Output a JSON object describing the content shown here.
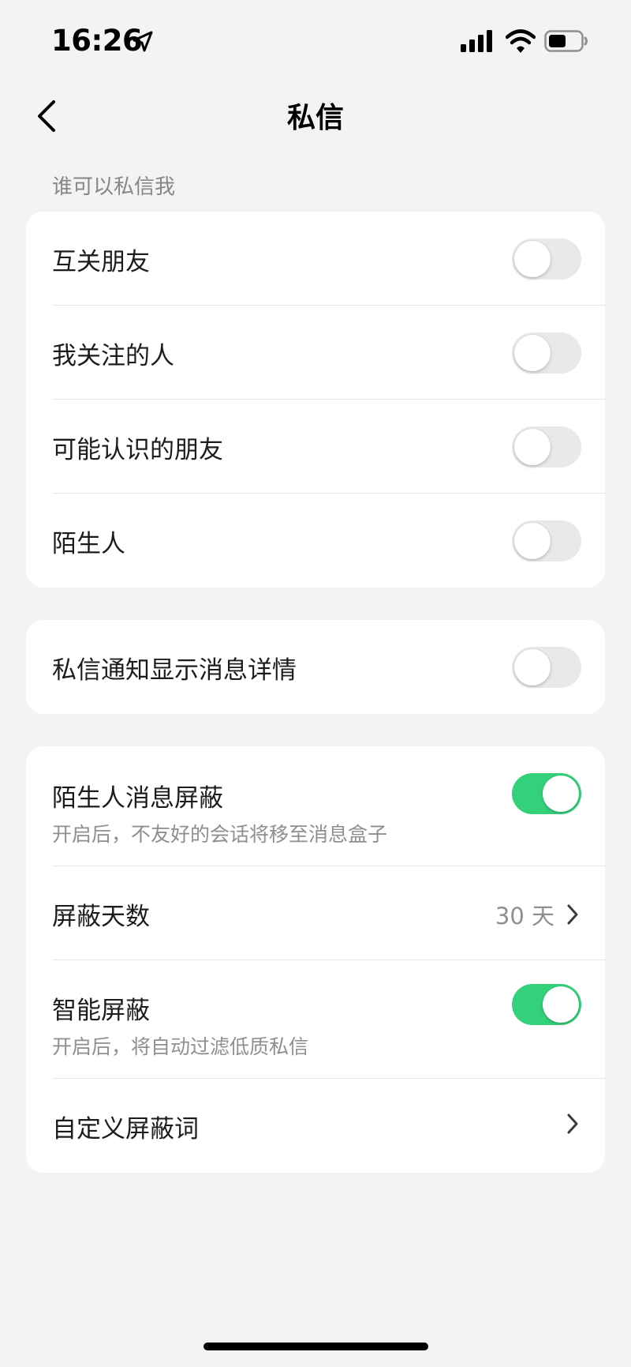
{
  "status_bar": {
    "time": "16:26",
    "icons": [
      "location-icon",
      "signal-icon",
      "wifi-icon",
      "battery-icon"
    ]
  },
  "nav": {
    "title": "私信",
    "back_icon": "chevron-left-icon"
  },
  "section_who": {
    "header": "谁可以私信我",
    "items": [
      {
        "label": "互关朋友",
        "on": false
      },
      {
        "label": "我关注的人",
        "on": false
      },
      {
        "label": "可能认识的朋友",
        "on": false
      },
      {
        "label": "陌生人",
        "on": false
      }
    ]
  },
  "notification": {
    "label": "私信通知显示消息详情",
    "on": false
  },
  "filter": {
    "stranger_block": {
      "label": "陌生人消息屏蔽",
      "sub": "开启后，不友好的会话将移至消息盒子",
      "on": true
    },
    "block_days": {
      "label": "屏蔽天数",
      "value": "30 天"
    },
    "smart_block": {
      "label": "智能屏蔽",
      "sub": "开启后，将自动过滤低质私信",
      "on": true
    },
    "custom_words": {
      "label": "自定义屏蔽词"
    }
  },
  "colors": {
    "toggle_on": "#34d17b",
    "toggle_off": "#e9e9eb",
    "background": "#f2f3f3"
  }
}
